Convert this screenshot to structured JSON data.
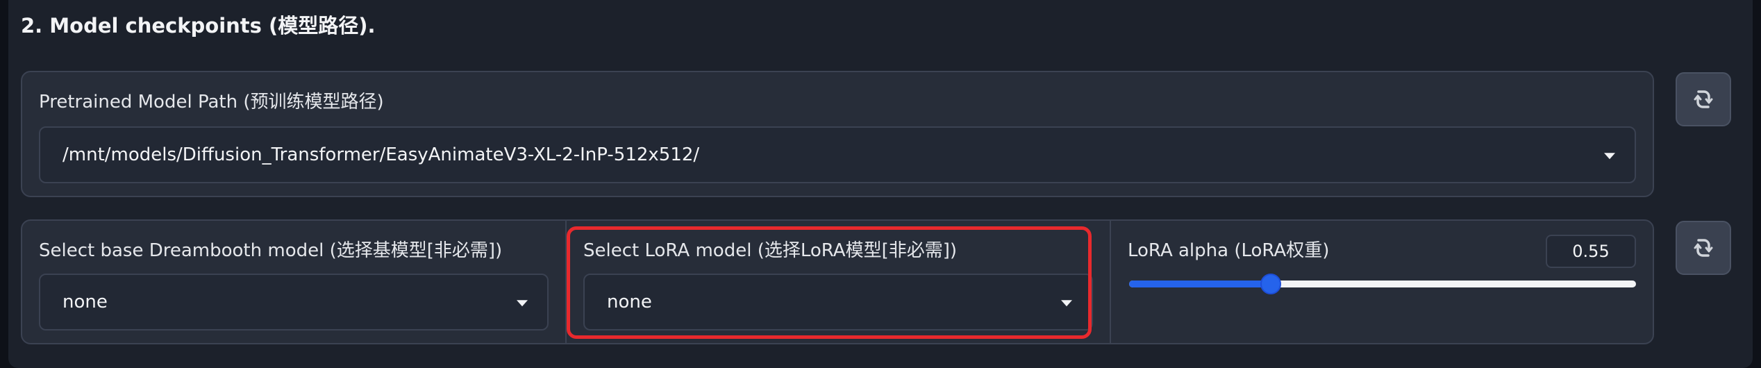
{
  "section": {
    "title": "2. Model checkpoints (模型路径)."
  },
  "pretrained": {
    "label": "Pretrained Model Path (预训练模型路径)",
    "value": "/mnt/models/Diffusion_Transformer/EasyAnimateV3-XL-2-InP-512x512/"
  },
  "base_model": {
    "label": "Select base Dreambooth model (选择基模型[非必需])",
    "value": "none"
  },
  "lora_model": {
    "label": "Select LoRA model (选择LoRA模型[非必需])",
    "value": "none"
  },
  "lora_alpha": {
    "label": "LoRA alpha (LoRA权重)",
    "value": "0.55",
    "fraction": 0.28
  },
  "colors": {
    "highlight": "#e8292d",
    "accent": "#2563eb"
  },
  "icons": {
    "refresh": "refresh-icon",
    "dropdown": "chevron-down-icon"
  }
}
